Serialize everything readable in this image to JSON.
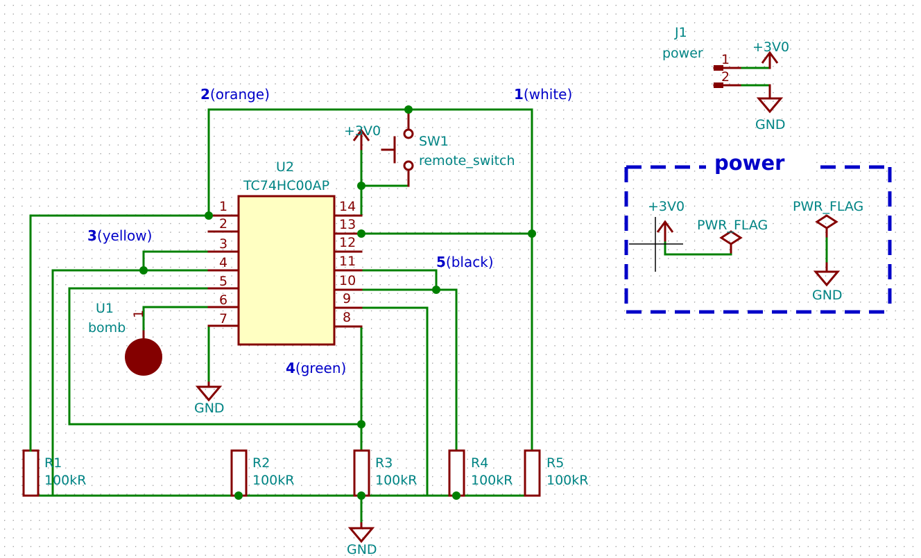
{
  "document": {
    "type": "schematic",
    "background_color": "#ffffff",
    "grid_color": "#9a9a9a",
    "wire_color": "#008000",
    "component_color": "#840000",
    "label_color": "#008484",
    "net_label_color": "#0000c8",
    "ic_fill_color": "#ffffc2"
  },
  "components": {
    "u2": {
      "ref": "U2",
      "value": "TC74HC00AP",
      "pins_left": [
        "1",
        "2",
        "3",
        "4",
        "5",
        "6",
        "7"
      ],
      "pins_right": [
        "14",
        "13",
        "12",
        "11",
        "10",
        "9",
        "8"
      ]
    },
    "u1": {
      "ref": "U1",
      "value": "bomb",
      "pin": "1"
    },
    "sw1": {
      "ref": "SW1",
      "value": "remote_switch"
    },
    "j1": {
      "ref": "J1",
      "value": "power",
      "pins": [
        "1",
        "2"
      ]
    },
    "resistors": [
      {
        "ref": "R1",
        "value": "100kR"
      },
      {
        "ref": "R2",
        "value": "100kR"
      },
      {
        "ref": "R3",
        "value": "100kR"
      },
      {
        "ref": "R4",
        "value": "100kR"
      },
      {
        "ref": "R5",
        "value": "100kR"
      }
    ]
  },
  "power_symbols": {
    "vcc_sw": "+3V0",
    "vcc_j1": "+3V0",
    "vcc_box": "+3V0",
    "gnd_bomb": "GND",
    "gnd_j1": "GND",
    "gnd_resistors": "GND",
    "gnd_box": "GND",
    "pwr_flag_left": "PWR_FLAG",
    "pwr_flag_right": "PWR_FLAG"
  },
  "net_labels": [
    {
      "num": "1",
      "name": "(white)"
    },
    {
      "num": "2",
      "name": "(orange)"
    },
    {
      "num": "3",
      "name": "(yellow)"
    },
    {
      "num": "4",
      "name": "(green)"
    },
    {
      "num": "5",
      "name": "(black)"
    }
  ],
  "sheet_block": {
    "title": "power",
    "border_color": "#0000c8"
  }
}
